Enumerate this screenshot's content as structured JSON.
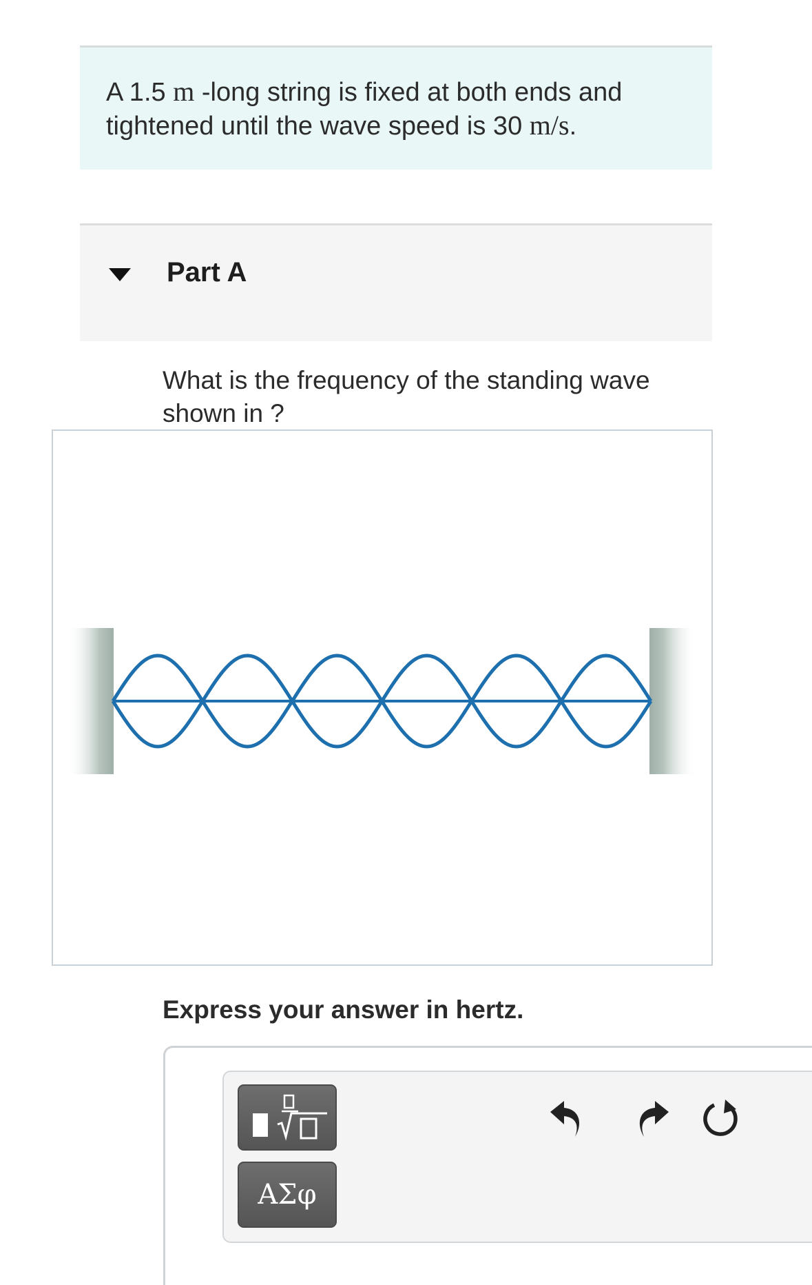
{
  "intro": {
    "prefix": "A 1.5 ",
    "length_unit": "m",
    "middle": " -long string is fixed at both ends and tightened until the wave speed is 30 ",
    "speed_unit": "m/s",
    "suffix": "."
  },
  "part": {
    "title": "Part A"
  },
  "question": {
    "text": "What is the frequency of the standing wave shown in ?"
  },
  "figure": {
    "loops": 6,
    "wave_color": "#1d6fae",
    "post_color": "#a9b8b1"
  },
  "answer": {
    "instruction": "Express your answer in hertz."
  },
  "toolbar": {
    "symbols_label": "ΑΣφ",
    "templates_icon": "fraction-radical-template-icon",
    "undo_icon": "undo-arrow-icon",
    "redo_icon": "redo-arrow-icon",
    "reset_icon": "reset-circular-arrow-icon"
  }
}
